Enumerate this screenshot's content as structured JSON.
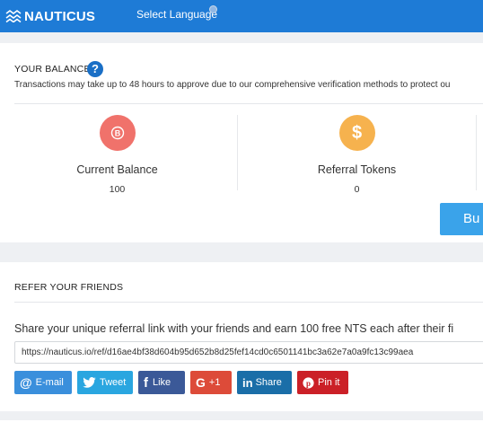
{
  "header": {
    "logo_text": "NAUTICUS",
    "language_label": "Select Language"
  },
  "balance": {
    "title": "YOUR BALANCE",
    "help_icon": "question-icon",
    "help_glyph": "?",
    "notice": "Transactions may take up to 48 hours to approve due to our comprehensive verification methods to protect ou",
    "stats": [
      {
        "label": "Current Balance",
        "value": "100",
        "icon": "bitcoin-icon",
        "color": "#f0726b"
      },
      {
        "label": "Referral Tokens",
        "value": "0",
        "icon": "dollar-icon",
        "color": "#f6b24e"
      }
    ],
    "buy_label": "Bu"
  },
  "refer": {
    "title": "REFER YOUR FRIENDS",
    "description": "Share your unique referral link with your friends and earn 100 free NTS each after their fi",
    "link": "https://nauticus.io/ref/d16ae4bf38d604b95d652b8d25fef14cd0c6501141bc3a62e7a0a9fc13c99aea",
    "share_buttons": [
      {
        "label": "E-mail",
        "icon": "email-icon",
        "color": "#3a8fdc"
      },
      {
        "label": "Tweet",
        "icon": "twitter-icon",
        "color": "#2aa6e0"
      },
      {
        "label": "Like",
        "icon": "facebook-icon",
        "color": "#3b5998"
      },
      {
        "label": "+1",
        "icon": "google-plus-icon",
        "color": "#dd4b39"
      },
      {
        "label": "Share",
        "icon": "linkedin-icon",
        "color": "#1a6ea8"
      },
      {
        "label": "Pin it",
        "icon": "pinterest-icon",
        "color": "#cb2027"
      }
    ]
  }
}
